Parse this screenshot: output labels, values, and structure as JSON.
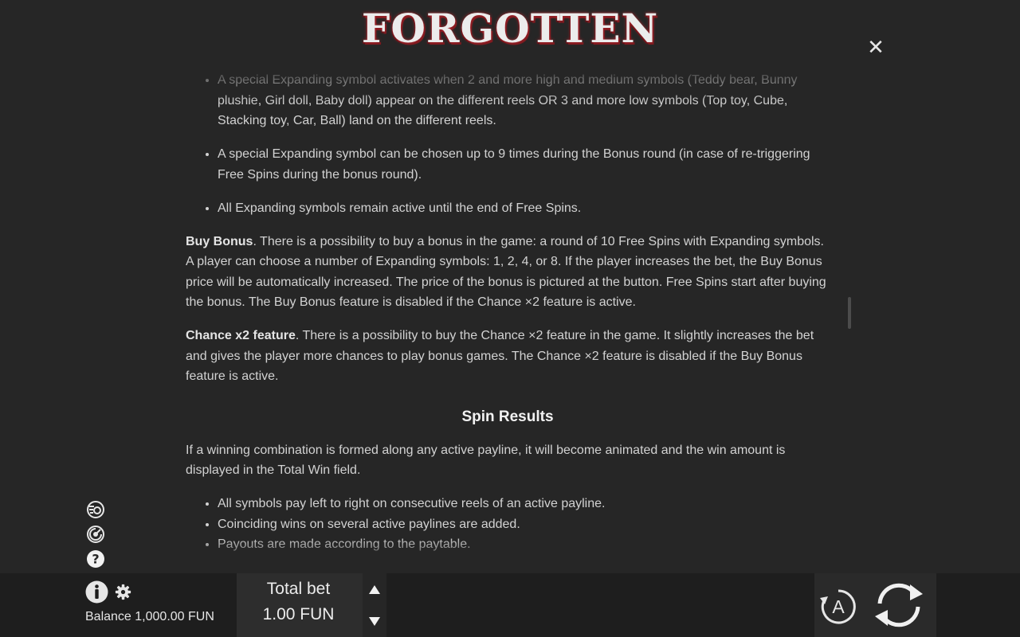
{
  "game": {
    "title": "FORGOTTEN"
  },
  "rules": {
    "bullets_top": [
      "A special Expanding symbol activates when 2 and more high and medium symbols (Teddy bear, Bunny plushie, Girl doll, Baby doll) appear on the different reels OR 3 and more low symbols (Top toy, Cube, Stacking toy, Car, Ball) land on the different reels.",
      "A special Expanding symbol can be chosen up to 9 times during the Bonus round (in case of re-triggering Free Spins during the bonus round).",
      "All Expanding symbols remain active until the end of Free Spins."
    ],
    "buy_bonus": {
      "title": "Buy Bonus",
      "text": ". There is a possibility to buy a bonus in the game: a round of 10 Free Spins with Expanding symbols. A player can choose a number of Expanding symbols: 1, 2, 4, or 8. If the player increases the bet, the Buy Bonus price will be automatically increased. The price of the bonus is pictured at the button. Free Spins start after buying the bonus. The Buy Bonus feature is disabled if the Chance ×2 feature is active."
    },
    "chance": {
      "title": "Chance x2 feature",
      "text": ". There is a possibility to buy the Chance ×2 feature in the game. It slightly increases the bet and gives the player more chances to play bonus games. The Chance ×2 feature is disabled if the Buy Bonus feature is active."
    },
    "spin_results": {
      "heading": "Spin Results",
      "intro": "If a winning combination is formed along any active payline, it will become animated and the win amount is displayed in the Total Win field.",
      "bullets": [
        "All symbols pay left to right on consecutive reels of an active payline.",
        "Coinciding wins on several active paylines are added.",
        "Payouts are made according to the paytable."
      ]
    }
  },
  "footer": {
    "balance_label": "Balance",
    "balance_value": "1,000.00 FUN",
    "total_bet_label": "Total bet",
    "total_bet_value": "1.00 FUN",
    "auto_label": "A"
  },
  "icons": {
    "close": "close-icon",
    "turbo": "turbo-icon",
    "sound": "sound-icon",
    "help": "help-icon",
    "info": "info-icon",
    "settings": "gear-icon",
    "up": "arrow-up-icon",
    "down": "arrow-down-icon",
    "autoplay": "autoplay-icon",
    "spin": "spin-icon"
  },
  "colors": {
    "background": "#262626",
    "text": "#d2d2d2",
    "logo_glow": "#b3262e"
  }
}
